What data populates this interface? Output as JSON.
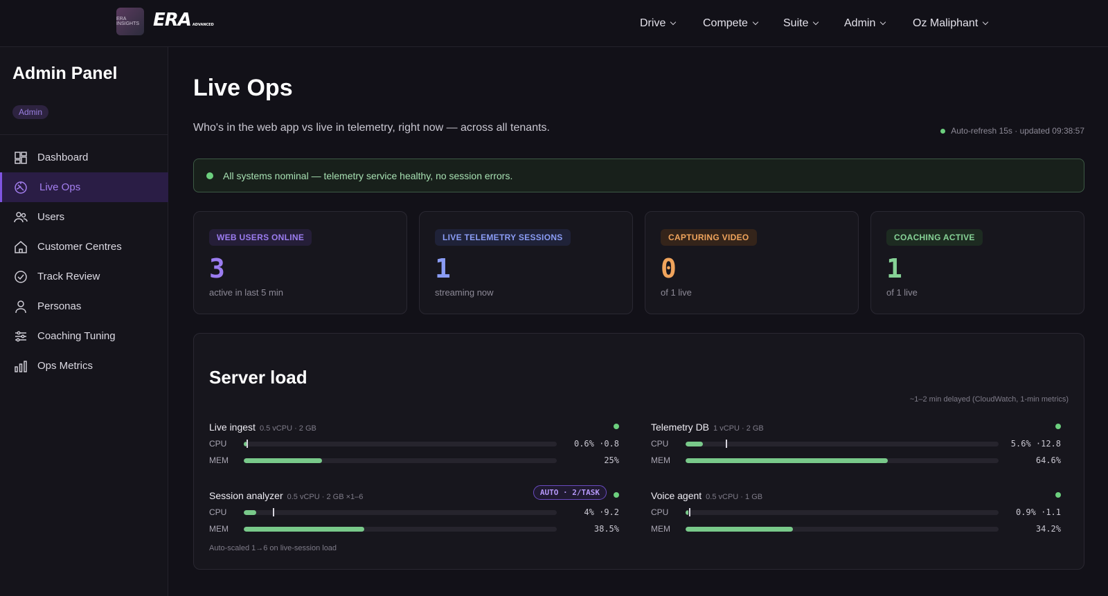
{
  "topbar": {
    "logo_badge_text": "ERA INSIGHTS",
    "logo_text": "ERA",
    "logo_sub": "ADVANCED",
    "nav": [
      {
        "label": "Drive"
      },
      {
        "label": "Compete"
      },
      {
        "label": "Suite"
      },
      {
        "label": "Admin"
      },
      {
        "label": "Oz Maliphant"
      }
    ]
  },
  "sidebar": {
    "title": "Admin Panel",
    "badge": "Admin",
    "items": [
      {
        "label": "Dashboard",
        "icon": "dashboard-icon"
      },
      {
        "label": "Live Ops",
        "icon": "live-ops-icon",
        "active": true
      },
      {
        "label": "Users",
        "icon": "users-icon"
      },
      {
        "label": "Customer Centres",
        "icon": "home-icon"
      },
      {
        "label": "Track Review",
        "icon": "check-circle-icon"
      },
      {
        "label": "Personas",
        "icon": "person-icon"
      },
      {
        "label": "Coaching Tuning",
        "icon": "sliders-icon"
      },
      {
        "label": "Ops Metrics",
        "icon": "bar-chart-icon"
      }
    ]
  },
  "main": {
    "title": "Live Ops",
    "subtitle": "Who's in the web app vs live in telemetry, right now — across all tenants.",
    "refresh": "Auto-refresh 15s · updated 09:38:57",
    "banner": "All systems nominal — telemetry service healthy, no session errors."
  },
  "cards": [
    {
      "tag": "WEB USERS ONLINE",
      "value": "3",
      "caption": "active in last 5 min",
      "color": "#9b7cf0",
      "tag_bg": "#251e38"
    },
    {
      "tag": "LIVE TELEMETRY SESSIONS",
      "value": "1",
      "caption": "streaming now",
      "color": "#8a9cf5",
      "tag_bg": "#1f2238"
    },
    {
      "tag": "CAPTURING VIDEO",
      "value": "0",
      "caption": "of 1 live",
      "color": "#f0a45c",
      "tag_bg": "#34241a"
    },
    {
      "tag": "COACHING ACTIVE",
      "value": "1",
      "caption": "of 1 live",
      "color": "#86d296",
      "tag_bg": "#1d2b21"
    }
  ],
  "server_load": {
    "title": "Server load",
    "note": "~1–2 min delayed (CloudWatch, 1-min metrics)",
    "footnote": "Auto-scaled 1→6 on live-session load",
    "services": [
      {
        "name": "Live ingest",
        "spec": "0.5 vCPU · 2 GB",
        "cpu": {
          "label": "CPU",
          "value": 0.6,
          "peak": 0.8,
          "text": "0.6% ·0.8"
        },
        "mem": {
          "label": "MEM",
          "value": 25,
          "text": "25%"
        }
      },
      {
        "name": "Telemetry DB",
        "spec": "1 vCPU · 2 GB",
        "cpu": {
          "label": "CPU",
          "value": 5.6,
          "peak": 12.8,
          "text": "5.6% ·12.8"
        },
        "mem": {
          "label": "MEM",
          "value": 64.6,
          "text": "64.6%"
        }
      },
      {
        "name": "Session analyzer",
        "spec": "0.5 vCPU · 2 GB ×1–6",
        "auto": "AUTO · 2/TASK",
        "cpu": {
          "label": "CPU",
          "value": 4,
          "peak": 9.2,
          "text": "4% ·9.2"
        },
        "mem": {
          "label": "MEM",
          "value": 38.5,
          "text": "38.5%"
        }
      },
      {
        "name": "Voice agent",
        "spec": "0.5 vCPU · 1 GB",
        "cpu": {
          "label": "CPU",
          "value": 0.9,
          "peak": 1.1,
          "text": "0.9% ·1.1"
        },
        "mem": {
          "label": "MEM",
          "value": 34.2,
          "text": "34.2%"
        }
      }
    ]
  }
}
